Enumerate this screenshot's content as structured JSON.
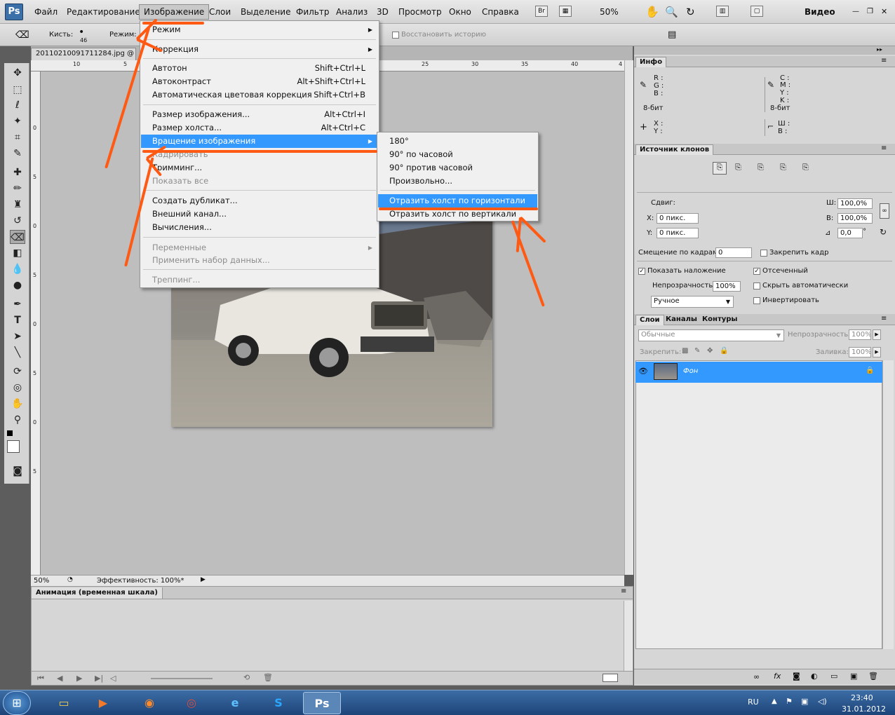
{
  "menubar": {
    "items": [
      "Файл",
      "Редактирование",
      "Изображение",
      "Слои",
      "Выделение",
      "Фильтр",
      "Анализ",
      "3D",
      "Просмотр",
      "Окно",
      "Справка"
    ],
    "zoom": "50%",
    "workspace": "Видео",
    "logo": "Ps",
    "bridge": "Br"
  },
  "options": {
    "brush_label": "Кисть:",
    "brush_size": "46",
    "mode_label": "Режим:",
    "restore_history": "Восстановить историю"
  },
  "document": {
    "tab": "20110210091711284.jpg @",
    "status_zoom": "50%",
    "status_text": "Эффективность: 100%*"
  },
  "ruler": {
    "h": [
      "10",
      "5",
      "25",
      "30",
      "35",
      "40",
      "4"
    ],
    "v": [
      "0",
      "5",
      "0",
      "5",
      "0",
      "5",
      "0",
      "5"
    ]
  },
  "image_menu": {
    "items": [
      {
        "label": "Режим",
        "shortcut": "",
        "sub": true
      },
      {
        "label": "Коррекция",
        "shortcut": "",
        "sub": true
      },
      {
        "label": "Автотон",
        "shortcut": "Shift+Ctrl+L"
      },
      {
        "label": "Автоконтраст",
        "shortcut": "Alt+Shift+Ctrl+L"
      },
      {
        "label": "Автоматическая цветовая коррекция",
        "shortcut": "Shift+Ctrl+B"
      },
      {
        "label": "Размер изображения...",
        "shortcut": "Alt+Ctrl+I"
      },
      {
        "label": "Размер холста...",
        "shortcut": "Alt+Ctrl+C"
      },
      {
        "label": "Вращение изображения",
        "shortcut": "",
        "sub": true
      },
      {
        "label": "Кадрировать",
        "shortcut": ""
      },
      {
        "label": "Тримминг...",
        "shortcut": ""
      },
      {
        "label": "Показать все",
        "shortcut": ""
      },
      {
        "label": "Создать дубликат...",
        "shortcut": ""
      },
      {
        "label": "Внешний канал...",
        "shortcut": ""
      },
      {
        "label": "Вычисления...",
        "shortcut": ""
      },
      {
        "label": "Переменные",
        "shortcut": "",
        "sub": true
      },
      {
        "label": "Применить набор данных...",
        "shortcut": ""
      },
      {
        "label": "Треппинг...",
        "shortcut": ""
      }
    ]
  },
  "rotate_menu": {
    "items": [
      "180°",
      "90° по часовой",
      "90° против часовой",
      "Произвольно...",
      "Отразить холст по горизонтали",
      "Отразить холст по вертикали"
    ]
  },
  "info_panel": {
    "title": "Инфо",
    "r": "R :",
    "g": "G :",
    "b": "B :",
    "c": "C :",
    "m": "M :",
    "y": "Y :",
    "k": "K :",
    "bits1": "8-бит",
    "bits2": "8-бит",
    "x": "X :",
    "ycoord": "Y :",
    "w": "Ш :",
    "h": "В :"
  },
  "clone_panel": {
    "title": "Источник клонов",
    "offset": "Сдвиг:",
    "x_label": "X:",
    "x_val": "0 пикс.",
    "y_label": "Y:",
    "y_val": "0 пикс.",
    "w_label": "Ш:",
    "w_val": "100,0%",
    "h_label": "В:",
    "h_val": "100,0%",
    "angle": "0,0",
    "deg": "°",
    "frame_offset": "Смещение по кадрам:",
    "frame_val": "0",
    "lock_frame": "Закрепить кадр",
    "show_overlay": "Показать наложение",
    "clipped": "Отсеченный",
    "opacity_label": "Непрозрачность:",
    "opacity_val": "100%",
    "auto_hide": "Скрыть автоматически",
    "mode": "Ручное",
    "invert": "Инвертировать"
  },
  "layers_panel": {
    "tabs": [
      "Слои",
      "Каналы",
      "Контуры"
    ],
    "blend": "Обычные",
    "opacity_label": "Непрозрачность:",
    "opacity": "100%",
    "lock_label": "Закрепить:",
    "fill_label": "Заливка:",
    "fill": "100%",
    "layer_name": "Фон"
  },
  "anim_panel": {
    "title": "Анимация (временная шкала)"
  },
  "taskbar": {
    "lang": "RU",
    "time": "23:40",
    "date": "31.01.2012"
  },
  "colors": {
    "highlight": "#3399ff",
    "annotation": "#ff5a14"
  }
}
